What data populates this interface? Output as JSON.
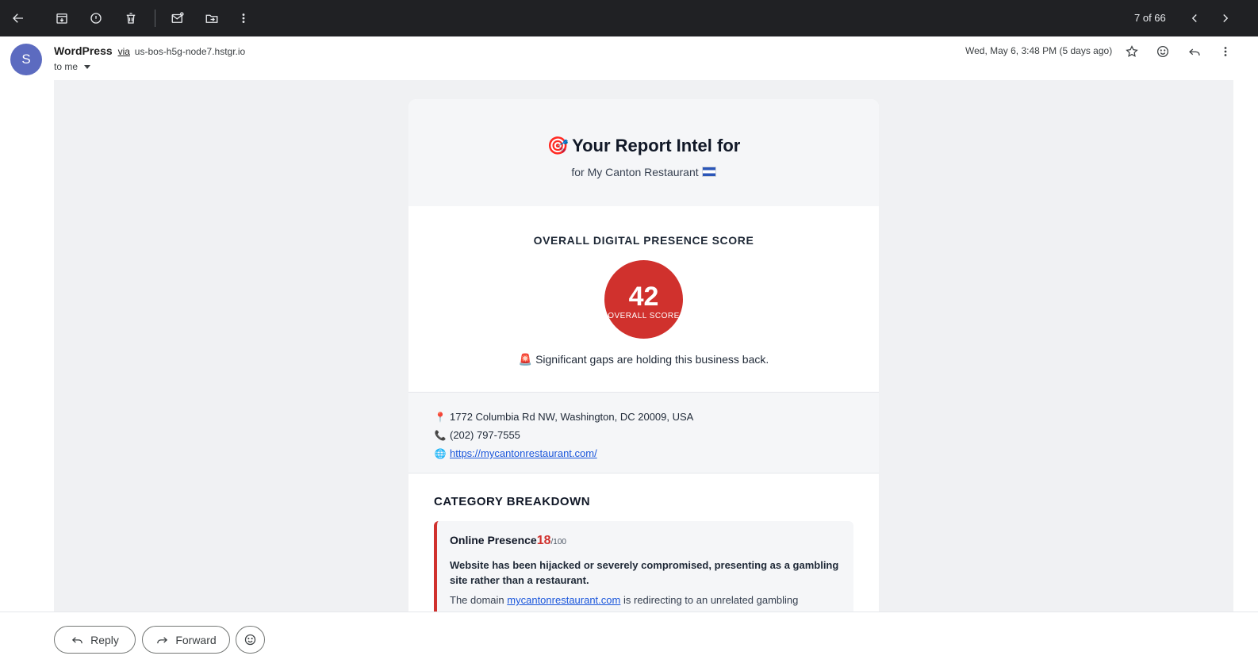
{
  "toolbar": {
    "pager_text": "7 of 66",
    "icons": [
      "back-arrow-icon",
      "archive-icon",
      "report-spam-icon",
      "delete-icon",
      "mark-unread-icon",
      "move-to-icon",
      "more-vertical-icon",
      "prev-chevron-icon",
      "next-chevron-icon"
    ]
  },
  "header": {
    "avatar_letter": "S",
    "sender_name": "WordPress",
    "via": "via",
    "sender_host": "us-bos-h5g-node7.hstgr.io",
    "to_label": "to me",
    "date": "Wed, May 6, 3:48 PM (5 days ago)"
  },
  "email": {
    "title_emoji": "🎯",
    "title": "Your Report Intel for",
    "subtitle": "for My Canton Restaurant",
    "score_label": "OVERALL DIGITAL PRESENCE SCORE",
    "score_value": "42",
    "score_caption": "OVERALL SCORE",
    "score_message_emoji": "🚨",
    "score_message": "Significant gaps are holding this business back.",
    "address": "1772 Columbia Rd NW, Washington, DC 20009, USA",
    "phone": "(202) 797-7555",
    "website": "https://mycantonrestaurant.com/",
    "category_title": "CATEGORY BREAKDOWN",
    "category": {
      "name": "Online Presence",
      "score": "18",
      "out_of": "/100",
      "headline": "Website has been hijacked or severely compromised, presenting as a gambling site rather than a restaurant.",
      "desc_prefix": "The domain",
      "desc_link": "mycantonrestaurant.com",
      "desc_suffix": "is redirecting to an unrelated gambling"
    }
  },
  "actions": {
    "reply_label": "Reply",
    "forward_label": "Forward"
  },
  "colors": {
    "score_red": "#d0312d",
    "topbar": "#202124",
    "avatar": "#5c6bc0",
    "link": "#1a56db"
  }
}
